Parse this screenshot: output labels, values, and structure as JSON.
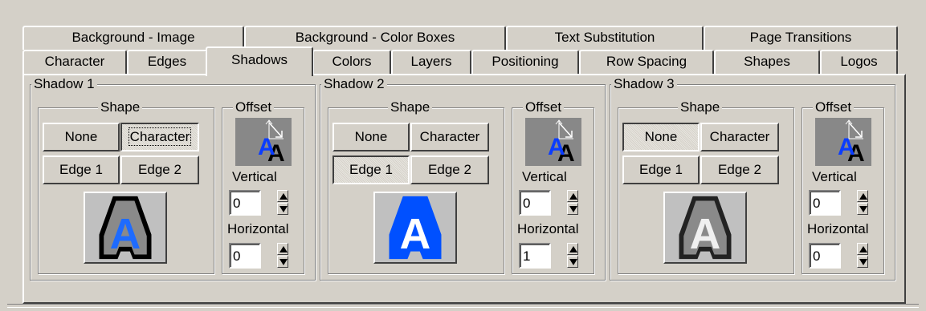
{
  "tabs_row1": [
    "Background - Image",
    "Background - Color Boxes",
    "Text Substitution",
    "Page Transitions"
  ],
  "tabs_row2": [
    "Character",
    "Edges",
    "Shadows",
    "Colors",
    "Layers",
    "Positioning",
    "Row Spacing",
    "Shapes",
    "Logos"
  ],
  "selected_tab": "Shadows",
  "shadows": [
    {
      "title": "Shadow 1",
      "shape_label": "Shape",
      "offset_label": "Offset",
      "none": "None",
      "character": "Character",
      "edge1": "Edge 1",
      "edge2": "Edge 2",
      "vertical_label": "Vertical",
      "vertical": "0",
      "horizontal_label": "Horizontal",
      "horizontal": "0",
      "selected_shape": "Character"
    },
    {
      "title": "Shadow 2",
      "shape_label": "Shape",
      "offset_label": "Offset",
      "none": "None",
      "character": "Character",
      "edge1": "Edge 1",
      "edge2": "Edge 2",
      "vertical_label": "Vertical",
      "vertical": "0",
      "horizontal_label": "Horizontal",
      "horizontal": "1",
      "selected_shape": "Edge 1"
    },
    {
      "title": "Shadow 3",
      "shape_label": "Shape",
      "offset_label": "Offset",
      "none": "None",
      "character": "Character",
      "edge1": "Edge 1",
      "edge2": "Edge 2",
      "vertical_label": "Vertical",
      "vertical": "0",
      "horizontal_label": "Horizontal",
      "horizontal": "0",
      "selected_shape": "None"
    }
  ],
  "icon_letters": {
    "fg": "A",
    "shadow": "A"
  },
  "colors": {
    "face": "#d4d0c8",
    "blue": "#0a3cff",
    "white": "#ffffff",
    "black": "#000000",
    "icon_bg": "#888888"
  }
}
